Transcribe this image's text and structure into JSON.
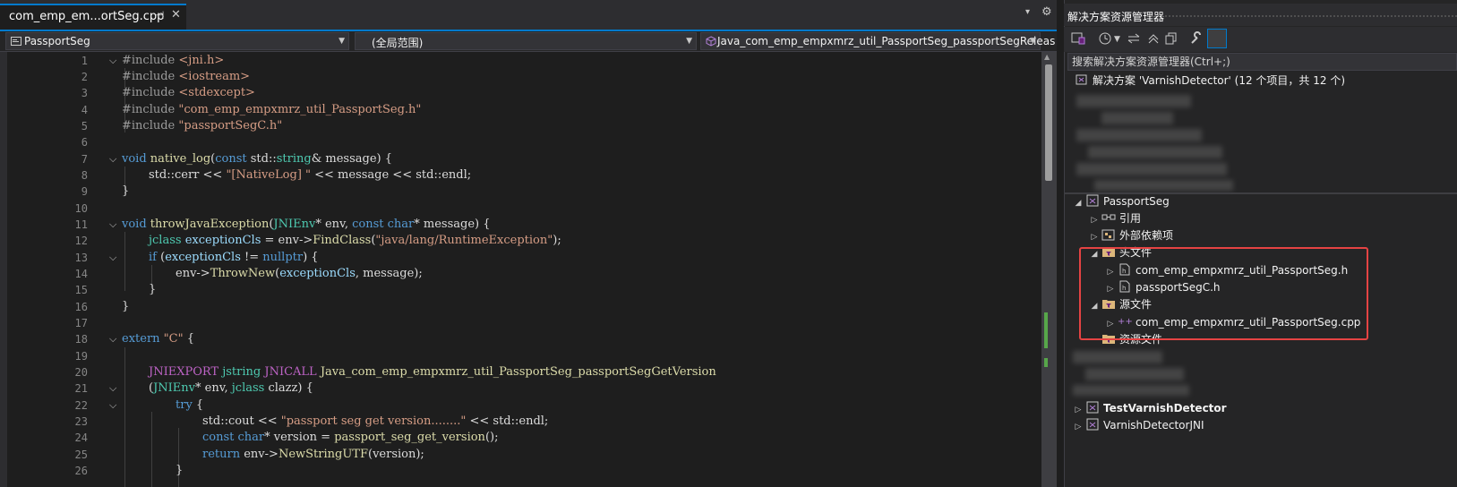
{
  "editor": {
    "tab": {
      "title": "com_emp_em...ortSeg.cpp",
      "pin": "⊣",
      "close": "✕"
    },
    "tab_menu": "▾",
    "settings": "⚙",
    "nav": {
      "project": "PassportSeg",
      "scope": "(全局范围)",
      "member": "Java_com_emp_empxmrz_util_PassportSeg_passportSegReleas"
    },
    "line_numbers": [
      "1",
      "2",
      "3",
      "4",
      "5",
      "6",
      "7",
      "8",
      "9",
      "10",
      "11",
      "12",
      "13",
      "14",
      "15",
      "16",
      "17",
      "18",
      "19",
      "20",
      "21",
      "22",
      "23",
      "24",
      "25",
      "26"
    ],
    "code": {
      "l1": {
        "a": "#include ",
        "b": "<jni.h>"
      },
      "l2": {
        "a": "#include ",
        "b": "<iostream>"
      },
      "l3": {
        "a": "#include ",
        "b": "<stdexcept>"
      },
      "l4": {
        "a": "#include ",
        "b": "\"com_emp_empxmrz_util_PassportSeg.h\""
      },
      "l5": {
        "a": "#include ",
        "b": "\"passportSegC.h\""
      },
      "l7": {
        "k": "void ",
        "f": "native_log",
        "p1": "(",
        "k2": "const ",
        "ns": "std::",
        "t": "string",
        "r": "& message) {"
      },
      "l8": {
        "a": "std::cerr << ",
        "s": "\"[NativeLog] \"",
        "b": " << message << std::endl;"
      },
      "l9": {
        "a": "}"
      },
      "l11": {
        "k": "void ",
        "f": "throwJavaException",
        "p1": "(",
        "t": "JNIEnv",
        "m1": "* env, ",
        "k2": "const char",
        "m2": "* message) {"
      },
      "l12": {
        "t": "jclass ",
        "v": "exceptionCls",
        "m1": " = env->",
        "f": "FindClass",
        "p": "(",
        "s": "\"java/lang/RuntimeException\"",
        "e": ");"
      },
      "l13": {
        "k": "if ",
        "p": "(",
        "v": "exceptionCls",
        "m": " != ",
        "k2": "nullptr",
        "e": ") {"
      },
      "l14": {
        "a": "env->",
        "f": "ThrowNew",
        "p": "(",
        "v": "exceptionCls",
        "e": ", message);"
      },
      "l15": {
        "a": "}"
      },
      "l16": {
        "a": "}"
      },
      "l18": {
        "k": "extern ",
        "s": "\"C\"",
        "e": " {"
      },
      "l20": {
        "m1": "JNIEXPORT ",
        "t": "jstring ",
        "m2": "JNICALL ",
        "f": "Java_com_emp_empxmrz_util_PassportSeg_passportSegGetVersion"
      },
      "l21": {
        "p": "(",
        "t": "JNIEnv",
        "m": "* env, ",
        "t2": "jclass ",
        "e": "clazz) {"
      },
      "l22": {
        "k": "try ",
        "e": "{"
      },
      "l23": {
        "a": "std::cout << ",
        "s": "\"passport seg get version........\"",
        "b": " << std::endl;"
      },
      "l24": {
        "k": "const char",
        "m": "* version = ",
        "f": "passport_seg_get_version",
        "e": "();"
      },
      "l25": {
        "k": "return ",
        "m": "env->",
        "f": "NewStringUTF",
        "p": "(",
        "e": "version);"
      },
      "l26": {
        "a": "}"
      }
    }
  },
  "solution_explorer": {
    "title": "解决方案资源管理器",
    "search_placeholder": "搜索解决方案资源管理器(Ctrl+;)",
    "solution_label": "解决方案 'VarnishDetector' (12 个项目，共 12 个)",
    "tree": {
      "project": "PassportSeg",
      "references": "引用",
      "external_deps": "外部依赖项",
      "header_files": "头文件",
      "header1": "com_emp_empxmrz_util_PassportSeg.h",
      "header2": "passportSegC.h",
      "source_files": "源文件",
      "source1": "com_emp_empxmrz_util_PassportSeg.cpp",
      "resource_files": "资源文件",
      "test_project": "TestVarnishDetector",
      "jni_project": "VarnishDetectorJNI"
    },
    "icons": {
      "toolbar": [
        "vs-switch-icon",
        "history-icon",
        "sync-icon",
        "collapse-icon",
        "copy-icon",
        "wrench-icon",
        "preview-icon"
      ]
    },
    "colors": {
      "highlight_box": "#e54343",
      "accent": "#007acc"
    }
  }
}
